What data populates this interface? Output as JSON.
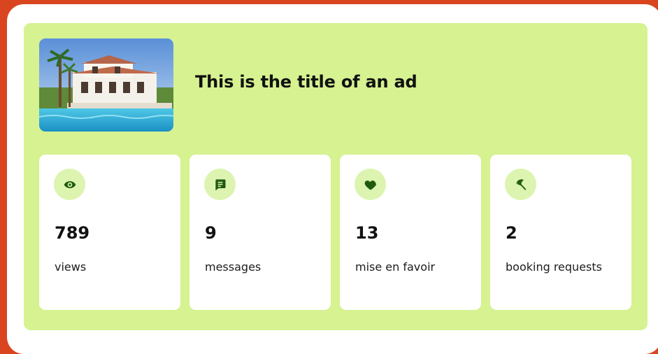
{
  "ad": {
    "title": "This is the title of an ad",
    "image_alt": "villa-with-pool-photo"
  },
  "stats": [
    {
      "value": "789",
      "label": "views",
      "icon": "eye-icon"
    },
    {
      "value": "9",
      "label": "messages",
      "icon": "message-icon"
    },
    {
      "value": "13",
      "label": "mise en favoir",
      "icon": "heart-icon"
    },
    {
      "value": "2",
      "label": "booking requests",
      "icon": "umbrella-icon"
    }
  ],
  "colors": {
    "frame": "#d9451f",
    "panel": "#d6f291",
    "icon_bg": "#ddf4b0",
    "icon_fg": "#1f5a0f"
  }
}
